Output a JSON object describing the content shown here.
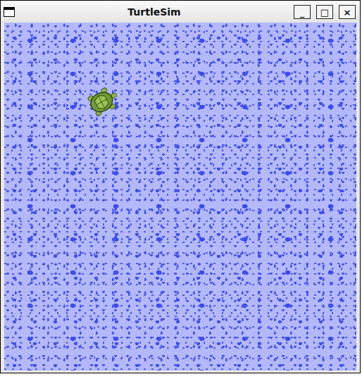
{
  "window": {
    "title": "TurtleSim",
    "controls": [
      {
        "label": "_"
      },
      {
        "label": "□"
      },
      {
        "label": "×"
      }
    ]
  }
}
